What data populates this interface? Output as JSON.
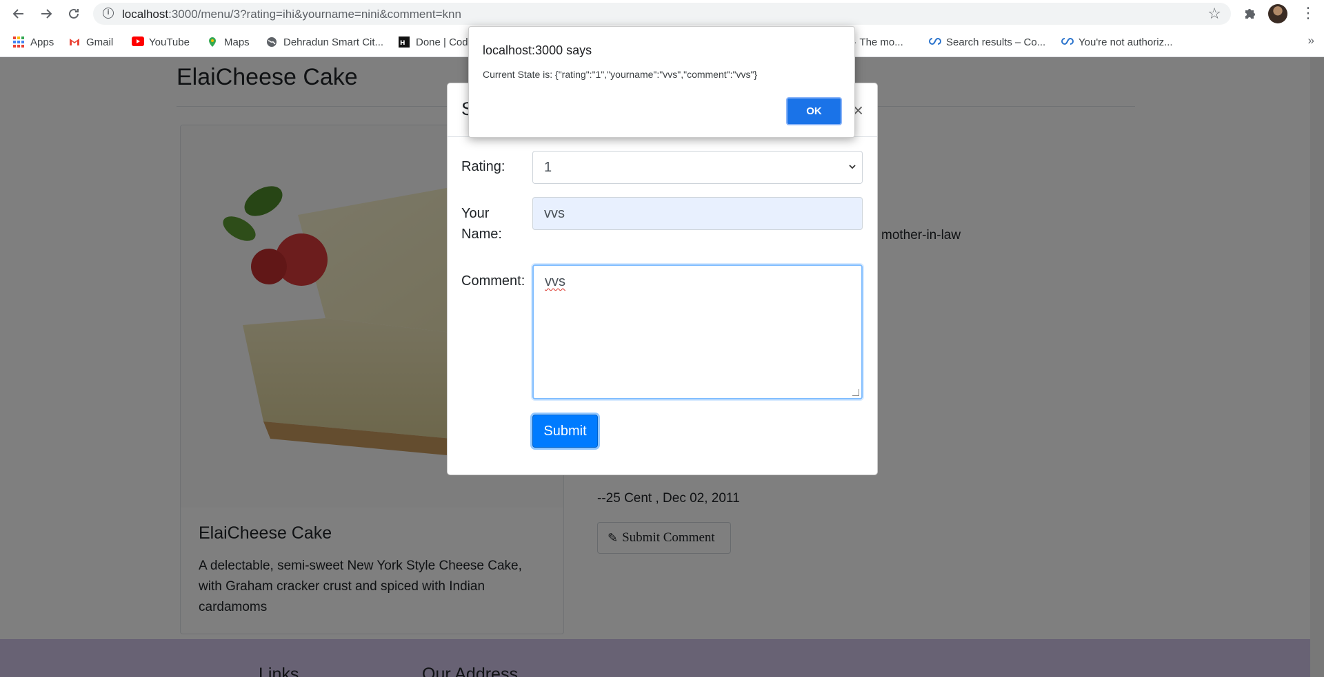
{
  "browser": {
    "url_host": "localhost",
    "url_rest": ":3000/menu/3?rating=ihi&yourname=nini&comment=knn",
    "bookmarks": [
      {
        "label": "Apps",
        "icon": "apps-grid-icon"
      },
      {
        "label": "Gmail",
        "icon": "gmail-icon"
      },
      {
        "label": "YouTube",
        "icon": "youtube-icon"
      },
      {
        "label": "Maps",
        "icon": "maps-icon"
      },
      {
        "label": "Dehradun Smart Cit...",
        "icon": "globe-icon"
      },
      {
        "label": "Done | Cod",
        "icon": "hackerearth-icon"
      },
      {
        "label": "p · The mo...",
        "icon": ""
      },
      {
        "label": "Search results – Co...",
        "icon": "coursera-icon"
      },
      {
        "label": "You're not authoriz...",
        "icon": "coursera-icon"
      }
    ],
    "more_label": "»"
  },
  "page": {
    "title": "ElaiCheese Cake",
    "card_title": "ElaiCheese Cake",
    "card_text": "A delectable, semi-sweet New York Style Cheese Cake, with Graham cracker crust and spiced with Indian cardamoms",
    "right_snippet": "mother-in-law",
    "comment_author": "--25 Cent , Dec 02, 2011",
    "submit_comment_label": "Submit Comment",
    "footer_links": "Links",
    "footer_address": "Our Address"
  },
  "modal": {
    "title_visible": "S",
    "close_glyph": "×",
    "rating_label": "Rating:",
    "rating_value": "1",
    "name_label": "Your Name:",
    "name_value": "vvs",
    "comment_label": "Comment:",
    "comment_value": "vvs",
    "submit_label": "Submit"
  },
  "alert": {
    "title": "localhost:3000 says",
    "message": "Current State is: {\"rating\":\"1\",\"yourname\":\"vvs\",\"comment\":\"vvs\"}",
    "ok_label": "OK"
  },
  "colors": {
    "primary": "#007bff",
    "alert_button": "#1a73e8",
    "footer": "#d1c4e9",
    "autofill": "#e8f0fe"
  }
}
